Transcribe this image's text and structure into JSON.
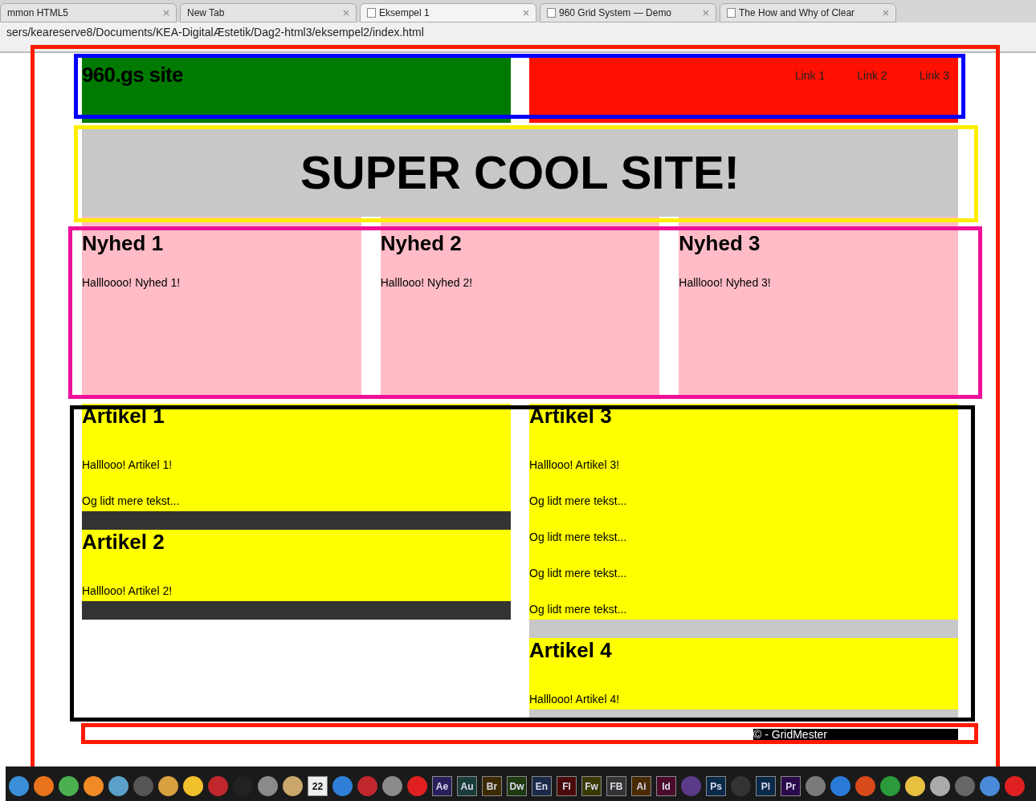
{
  "browser": {
    "tabs": [
      {
        "label": "mmon HTML5",
        "selected": false,
        "page_icon": false
      },
      {
        "label": "New Tab",
        "selected": false,
        "page_icon": false
      },
      {
        "label": "Eksempel 1",
        "selected": true,
        "page_icon": true
      },
      {
        "label": "960 Grid System — Demo",
        "selected": false,
        "page_icon": true
      },
      {
        "label": "The How and Why of Clear",
        "selected": false,
        "page_icon": true
      }
    ],
    "address": "sers/keareserve8/Documents/KEA-DigitalÆstetik/Dag2-html3/eksempel2/index.html"
  },
  "page": {
    "header": {
      "title": "960.gs site",
      "links": [
        "Link 1",
        "Link 2",
        "Link 3"
      ]
    },
    "banner": "SUPER COOL SITE!",
    "news": [
      {
        "title": "Nyhed 1",
        "text": "Hallloooo! Nyhed 1!"
      },
      {
        "title": "Nyhed 2",
        "text": "Halllooo! Nyhed 2!"
      },
      {
        "title": "Nyhed 3",
        "text": "Halllooo! Nyhed 3!"
      }
    ],
    "article_columns": [
      {
        "color": "#333333",
        "articles": [
          {
            "title": "Artikel 1",
            "paragraphs": [
              "Halllooo! Artikel 1!",
              "Og lidt mere tekst..."
            ]
          },
          {
            "title": "Artikel 2",
            "paragraphs": [
              "Halllooo! Artikel 2!"
            ]
          }
        ]
      },
      {
        "color": "#c8c8c8",
        "articles": [
          {
            "title": "Artikel 3",
            "paragraphs": [
              "Halllooo! Artikel 3!",
              "Og lidt mere tekst...",
              "Og lidt mere tekst...",
              "Og lidt mere tekst...",
              "Og lidt mere tekst..."
            ]
          },
          {
            "title": "Artikel 4",
            "paragraphs": [
              "Halllooo! Artikel 4!"
            ]
          }
        ]
      }
    ],
    "footer": "© - GridMester"
  },
  "annotations": [
    {
      "kind": "page",
      "color": "#ff1a00"
    },
    {
      "kind": "header",
      "color": "#0000ff"
    },
    {
      "kind": "banner",
      "color": "#ffee00"
    },
    {
      "kind": "news",
      "color": "#ee1199"
    },
    {
      "kind": "articles",
      "color": "#000000"
    },
    {
      "kind": "footer",
      "color": "#ff1a00"
    }
  ],
  "dock": [
    {
      "kind": "icon",
      "color": "#3a8fd8"
    },
    {
      "kind": "icon",
      "color": "#e8731c"
    },
    {
      "kind": "icon",
      "color": "#4caf50"
    },
    {
      "kind": "icon",
      "color": "#f08a24"
    },
    {
      "kind": "icon",
      "color": "#5aa0c8"
    },
    {
      "kind": "icon",
      "color": "#555555"
    },
    {
      "kind": "icon",
      "color": "#d9a040"
    },
    {
      "kind": "icon",
      "color": "#f2c02c"
    },
    {
      "kind": "icon",
      "color": "#c0272d"
    },
    {
      "kind": "icon",
      "color": "#222222"
    },
    {
      "kind": "icon",
      "color": "#8a8a8a"
    },
    {
      "kind": "icon",
      "color": "#c9a66b"
    },
    {
      "kind": "text",
      "label": "22",
      "color": "#eeeeee"
    },
    {
      "kind": "icon",
      "color": "#2f7fd8"
    },
    {
      "kind": "icon",
      "color": "#c0272d"
    },
    {
      "kind": "icon",
      "color": "#8a8a8a"
    },
    {
      "kind": "icon",
      "color": "#e02020"
    },
    {
      "kind": "text",
      "label": "Ae",
      "color": "#2a1e5c"
    },
    {
      "kind": "text",
      "label": "Au",
      "color": "#1a3d3a"
    },
    {
      "kind": "text",
      "label": "Br",
      "color": "#3d2a00"
    },
    {
      "kind": "text",
      "label": "Dw",
      "color": "#1e3a10"
    },
    {
      "kind": "text",
      "label": "En",
      "color": "#1c2a4a"
    },
    {
      "kind": "text",
      "label": "Fl",
      "color": "#4a0a0a"
    },
    {
      "kind": "text",
      "label": "Fw",
      "color": "#3a3a00"
    },
    {
      "kind": "text",
      "label": "FB",
      "color": "#333333"
    },
    {
      "kind": "text",
      "label": "Ai",
      "color": "#4a2a00"
    },
    {
      "kind": "text",
      "label": "Id",
      "color": "#4a0a2a"
    },
    {
      "kind": "icon",
      "color": "#5c3a8a"
    },
    {
      "kind": "text",
      "label": "Ps",
      "color": "#0a2a4a"
    },
    {
      "kind": "icon",
      "color": "#333333"
    },
    {
      "kind": "text",
      "label": "Pl",
      "color": "#0a2a4a"
    },
    {
      "kind": "text",
      "label": "Pr",
      "color": "#2a0a4a"
    },
    {
      "kind": "icon",
      "color": "#7a7a7a"
    },
    {
      "kind": "icon",
      "color": "#2a7ad8"
    },
    {
      "kind": "icon",
      "color": "#d84a1a"
    },
    {
      "kind": "icon",
      "color": "#2a9a3a"
    },
    {
      "kind": "icon",
      "color": "#e8c040"
    },
    {
      "kind": "icon",
      "color": "#aaaaaa"
    },
    {
      "kind": "icon",
      "color": "#666666"
    },
    {
      "kind": "icon",
      "color": "#4a8ad8"
    },
    {
      "kind": "icon",
      "color": "#e02020"
    }
  ]
}
